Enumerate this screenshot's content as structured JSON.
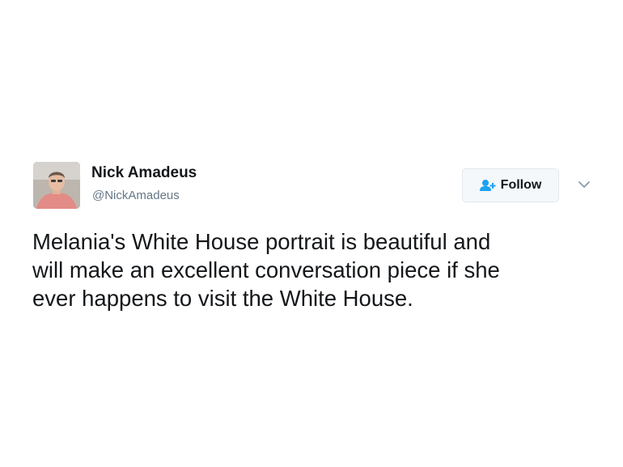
{
  "tweet": {
    "author": {
      "display_name": "Nick Amadeus",
      "screen_name": "@NickAmadeus",
      "avatar_icon": "profile-photo"
    },
    "follow_button": {
      "label": "Follow",
      "icon": "add-user-icon",
      "accent_color": "#1da1f2"
    },
    "menu_icon": "chevron-down-icon",
    "text_lines": [
      "Melania's White House portrait is beautiful and",
      "will make an excellent conversation piece if she",
      "ever happens to visit the White House."
    ]
  }
}
